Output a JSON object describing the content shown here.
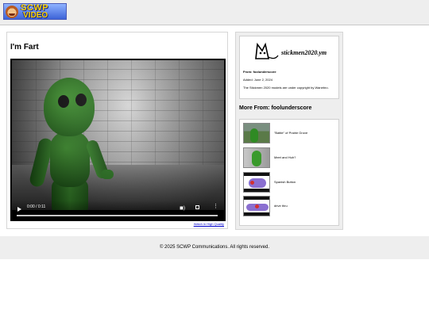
{
  "header": {
    "logo_line1": "SCWP",
    "logo_line2": "VIDEO"
  },
  "video": {
    "title": "I'm Fart",
    "current_time": "0:00 / 0:11",
    "progress": 0,
    "hq_link": "Watch in High Quality"
  },
  "info": {
    "banner_text": "stickmen2020.ym",
    "from": "From: foolunderscore",
    "added": "Added: June 2, 2024",
    "copyright": "The Stickmen 2020 models are under copyright by Wanebro."
  },
  "more_from": {
    "heading": "More From: foolunderscore",
    "items": [
      {
        "label": "\"Battle\" of Prairie Grove"
      },
      {
        "label": "Meet and Huh?"
      },
      {
        "label": "Spanish Button"
      },
      {
        "label": "drive thru"
      }
    ]
  },
  "footer": {
    "text": "© 2025 SCWP Communications. All rights reserved."
  },
  "colors": {
    "accent_link": "#0000cc",
    "panel_bg": "#eeeeee"
  }
}
